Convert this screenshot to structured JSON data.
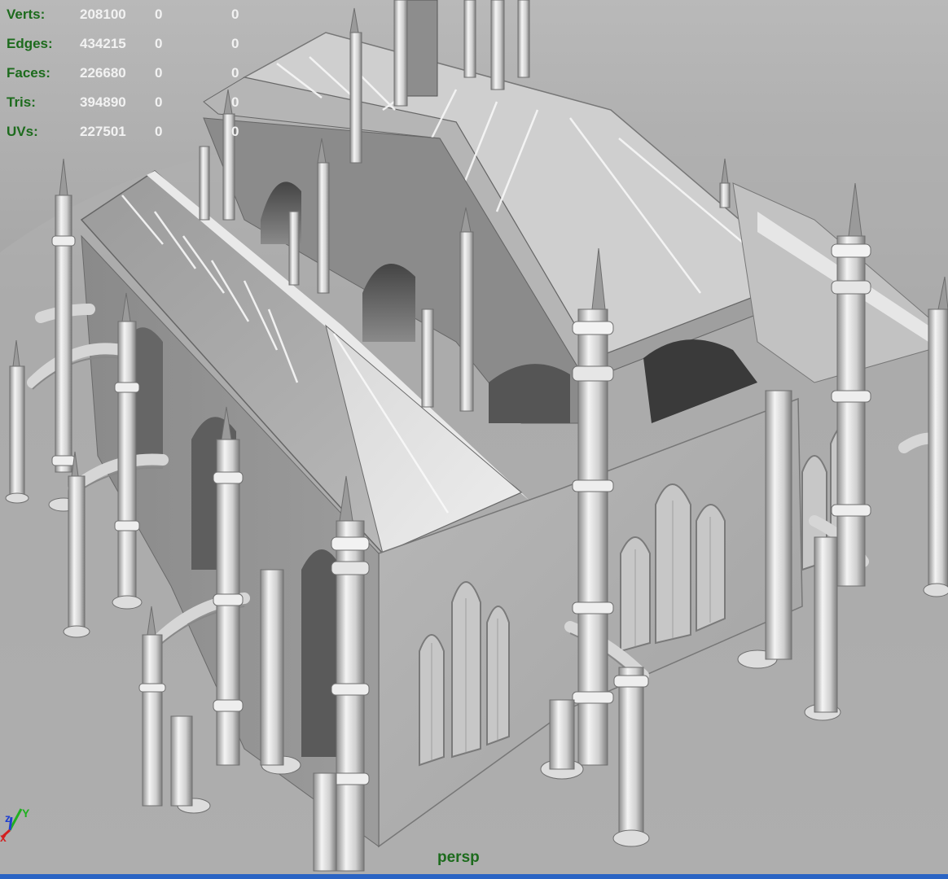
{
  "viewport": {
    "camera_name": "persp",
    "accent_bar_color": "#2a64c4",
    "hud_label_color": "#1d6b1d",
    "hud_value_color": "#f2f2f2"
  },
  "hud": {
    "rows": [
      {
        "label": "Verts:",
        "value": "208100",
        "sel1": "0",
        "sel2": "0"
      },
      {
        "label": "Edges:",
        "value": "434215",
        "sel1": "0",
        "sel2": "0"
      },
      {
        "label": "Faces:",
        "value": "226680",
        "sel1": "0",
        "sel2": "0"
      },
      {
        "label": "Tris:",
        "value": "394890",
        "sel1": "0",
        "sel2": "0"
      },
      {
        "label": "UVs:",
        "value": "227501",
        "sel1": "0",
        "sel2": "0"
      }
    ]
  },
  "axis_gizmo": {
    "x_label": "x",
    "y_label": "Y",
    "z_label": "z",
    "x_color": "#d22020",
    "y_color": "#20b020",
    "z_color": "#2040d0"
  }
}
